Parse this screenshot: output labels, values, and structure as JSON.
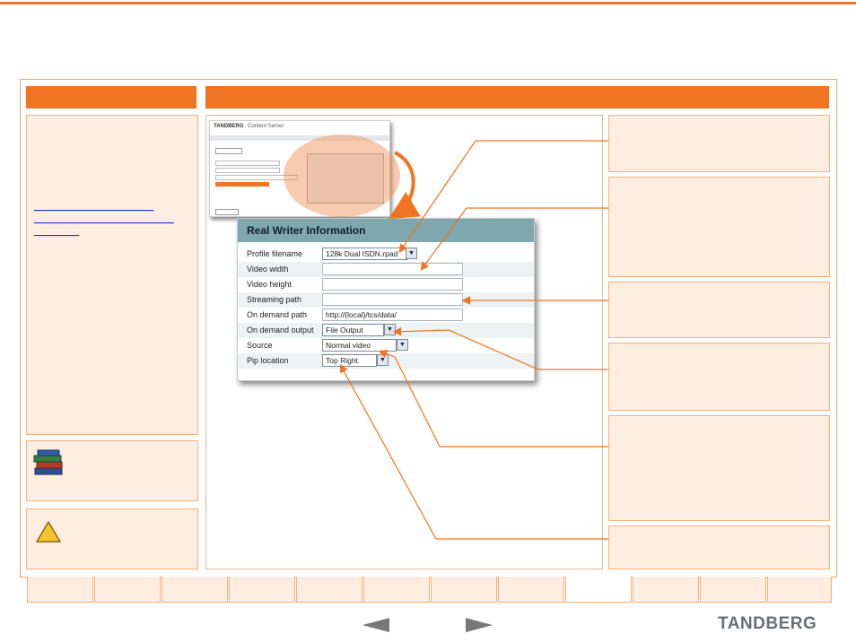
{
  "sidebar": {
    "link_text": "________________________ ____________________________ _________"
  },
  "real_writer": {
    "title": "Real Writer Information",
    "fields": [
      {
        "label": "Profile filename",
        "value": "128k Dual ISDN.rpad",
        "type": "select"
      },
      {
        "label": "Video width",
        "value": "",
        "type": "input"
      },
      {
        "label": "Video height",
        "value": "",
        "type": "input"
      },
      {
        "label": "Streaming path",
        "value": "",
        "type": "input"
      },
      {
        "label": "On demand path",
        "value": "http://{local}/tcs/data/",
        "type": "input"
      },
      {
        "label": "On demand output",
        "value": "File Output",
        "type": "select"
      },
      {
        "label": "Source",
        "value": "Normal video",
        "type": "select"
      },
      {
        "label": "Pip location",
        "value": "Top Right",
        "type": "select"
      }
    ]
  },
  "thumbnail": {
    "brand": "TANDBERG",
    "product": "Content Server"
  },
  "nav": {
    "prev_icon": "left-arrow-icon",
    "next_icon": "right-arrow-icon"
  },
  "brand": {
    "logo_text": "TANDBERG",
    "accent_color": "#f07422"
  }
}
